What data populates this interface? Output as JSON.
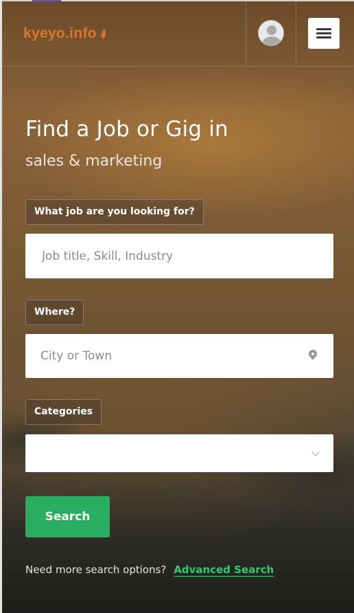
{
  "brand": {
    "logo_text": "kyeyo.info",
    "logo_mark": "broom-icon"
  },
  "header": {
    "avatar": "user-avatar-icon",
    "menu": "hamburger-menu-icon"
  },
  "hero": {
    "title": "Find a Job or Gig in",
    "subtitle": "sales & marketing"
  },
  "search": {
    "job_label": "What job are you looking for?",
    "job_placeholder": "Job title, Skill, Industry",
    "where_label": "Where?",
    "where_placeholder": "City or Town",
    "categories_label": "Categories",
    "categories_value": "",
    "submit_label": "Search"
  },
  "footer_prompt": {
    "text": "Need more search options?",
    "link": "Advanced Search"
  },
  "colors": {
    "brand": "#d9772a",
    "accent_green": "#27ae60",
    "link_green": "#2ecc71"
  }
}
